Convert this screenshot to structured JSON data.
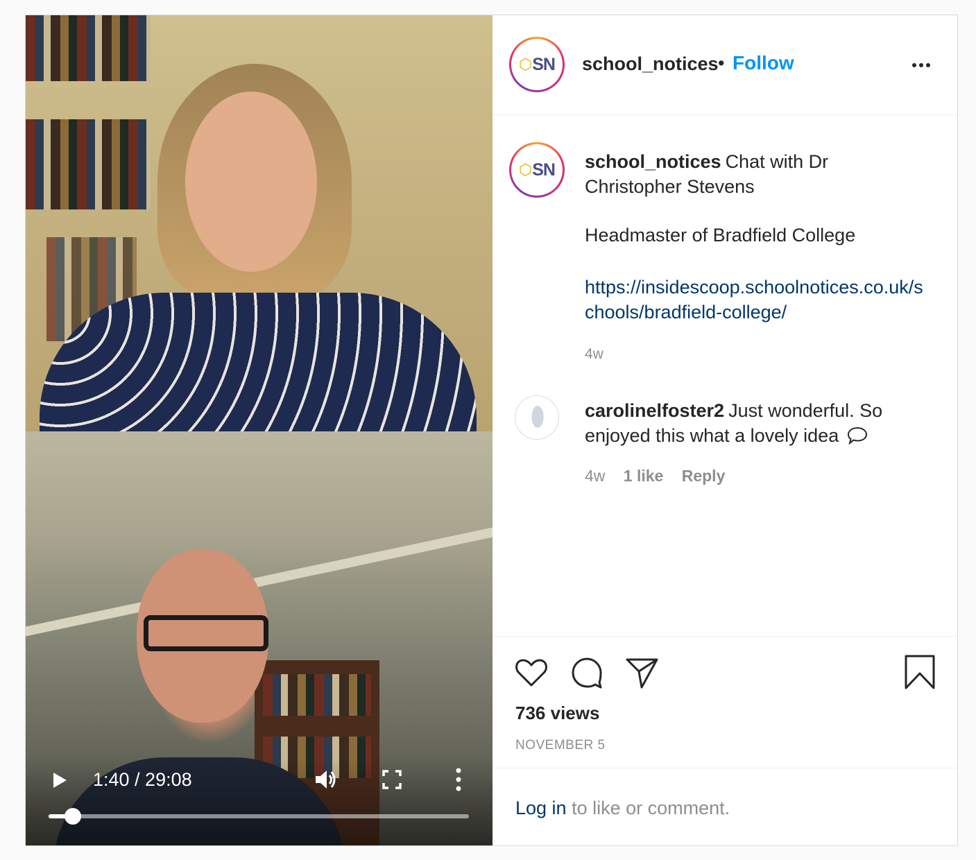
{
  "video": {
    "time_display": "1:40 / 29:08",
    "progress_fraction": 0.0573
  },
  "header": {
    "avatar_text": "SN",
    "username": "school_notices",
    "separator": "•",
    "follow_label": "Follow"
  },
  "caption": {
    "avatar_text": "SN",
    "username": "school_notices",
    "text_line1": "Chat with Dr",
    "text_line2": "Christopher Stevens",
    "subtitle": "Headmaster of Bradfield College",
    "link": "https://insidescoop.schoolnotices.co.uk/schools/bradfield-college/",
    "age": "4w"
  },
  "comment": {
    "username": "carolinelfoster2",
    "text": "Just wonderful. So enjoyed this what a lovely idea",
    "age": "4w",
    "likes": "1 like",
    "reply_label": "Reply"
  },
  "stats": {
    "views": "736 views",
    "date": "NOVEMBER 5"
  },
  "login_prompt": {
    "link_label": "Log in",
    "rest": "to like or comment."
  },
  "colors": {
    "follow_blue": "#0095f6",
    "link_blue": "#00376b",
    "muted": "#8e8e8e"
  }
}
